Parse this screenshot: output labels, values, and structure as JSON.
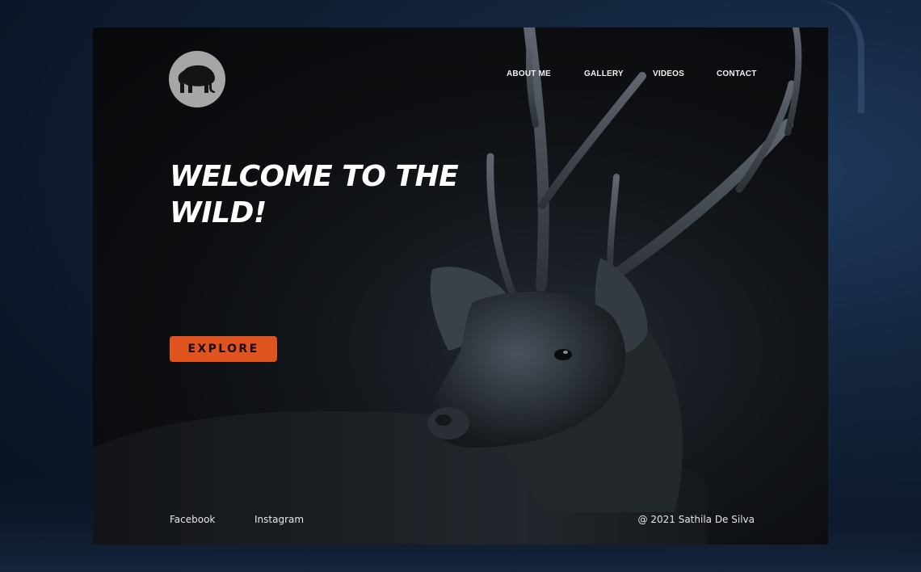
{
  "logo": {
    "icon": "elephant-icon",
    "color": "#a6a6a6"
  },
  "nav": {
    "items": [
      {
        "label": "ABOUT ME"
      },
      {
        "label": "GALLERY"
      },
      {
        "label": "VIDEOS"
      },
      {
        "label": "CONTACT"
      }
    ]
  },
  "hero": {
    "headline_line1": "WELCOME TO THE",
    "headline_line2": "WILD!",
    "cta_label": "EXPLORE",
    "cta_color": "#e0541f"
  },
  "footer": {
    "links": [
      {
        "label": "Facebook"
      },
      {
        "label": "Instagram"
      }
    ],
    "copyright": "@ 2021 Sathila De Silva"
  },
  "colors": {
    "backdrop": "#13243c",
    "card": "#0c0e11",
    "accent": "#e0541f"
  }
}
